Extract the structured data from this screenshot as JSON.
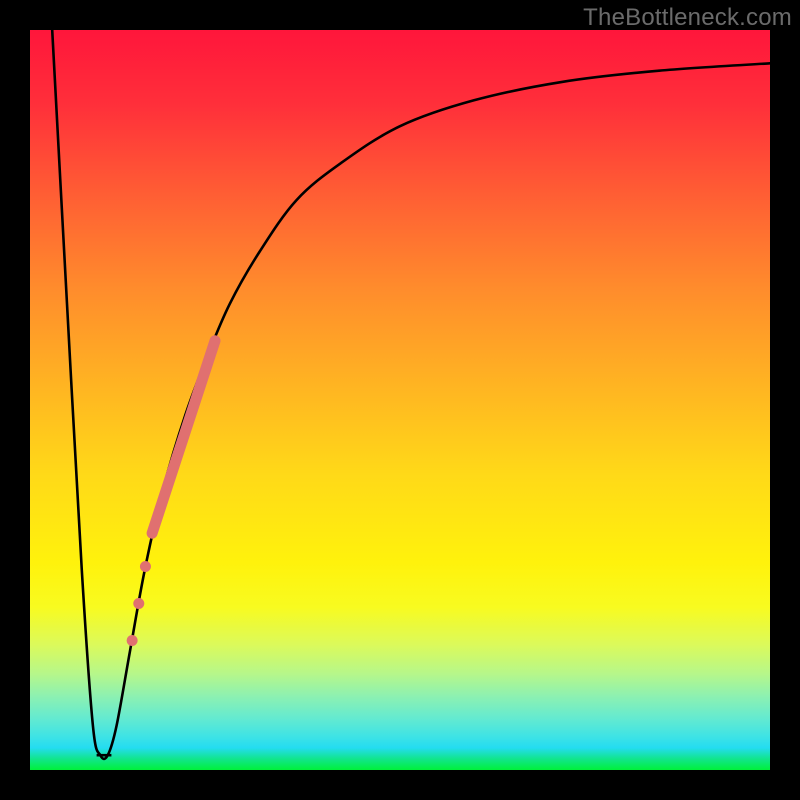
{
  "watermark": "TheBottleneck.com",
  "chart_data": {
    "type": "line",
    "title": "",
    "xlabel": "",
    "ylabel": "",
    "xlim": [
      0,
      100
    ],
    "ylim": [
      0,
      100
    ],
    "grid": false,
    "series": [
      {
        "name": "bottleneck-curve",
        "x": [
          3,
          5,
          7,
          8.5,
          9.5,
          10.5,
          11.7,
          13.5,
          15.5,
          18,
          21,
          24,
          27,
          31,
          36,
          42,
          50,
          60,
          72,
          85,
          100
        ],
        "y": [
          100,
          63,
          27,
          6,
          2,
          2,
          6,
          16,
          27,
          38,
          48,
          56,
          63,
          70,
          77,
          82,
          87,
          90.5,
          93,
          94.5,
          95.5
        ]
      }
    ],
    "flat_bottom": {
      "x_start": 9,
      "x_end": 11,
      "y": 2
    },
    "highlight": {
      "name": "dot-band",
      "color": "#e07070",
      "stroke_width": 11,
      "segment": {
        "x_start": 16.5,
        "x_end": 25,
        "y_start": 32,
        "y_end": 58
      },
      "dots": [
        {
          "x": 15.6,
          "y": 27.5,
          "r": 5.5
        },
        {
          "x": 14.7,
          "y": 22.5,
          "r": 5.5
        },
        {
          "x": 13.8,
          "y": 17.5,
          "r": 5.5
        }
      ]
    }
  }
}
